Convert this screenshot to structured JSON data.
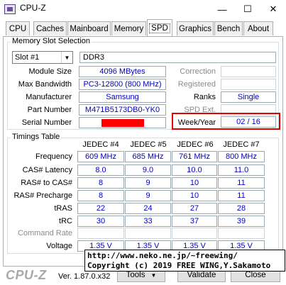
{
  "window": {
    "title": "CPU-Z",
    "minimize": "—",
    "maximize": "☐",
    "close": "✕"
  },
  "tabs": [
    "CPU",
    "Caches",
    "Mainboard",
    "Memory",
    "SPD",
    "Graphics",
    "Bench",
    "About"
  ],
  "active_tab": "SPD",
  "slot": {
    "group_title": "Memory Slot Selection",
    "selected": "Slot #1",
    "type": "DDR3",
    "module_size_label": "Module Size",
    "module_size": "4096 MBytes",
    "max_bw_label": "Max Bandwidth",
    "max_bw": "PC3-12800 (800 MHz)",
    "manufacturer_label": "Manufacturer",
    "manufacturer": "Samsung",
    "part_label": "Part Number",
    "part": "M471B5173DB0-YK0",
    "serial_label": "Serial Number",
    "correction_label": "Correction",
    "registered_label": "Registered",
    "ranks_label": "Ranks",
    "ranks": "Single",
    "spdext_label": "SPD Ext.",
    "weekyear_label": "Week/Year",
    "weekyear": "02 / 16"
  },
  "timings": {
    "group_title": "Timings Table",
    "columns": [
      "JEDEC #4",
      "JEDEC #5",
      "JEDEC #6",
      "JEDEC #7"
    ],
    "rows": [
      {
        "label": "Frequency",
        "values": [
          "609 MHz",
          "685 MHz",
          "761 MHz",
          "800 MHz"
        ]
      },
      {
        "label": "CAS# Latency",
        "values": [
          "8.0",
          "9.0",
          "10.0",
          "11.0"
        ]
      },
      {
        "label": "RAS# to CAS#",
        "values": [
          "8",
          "9",
          "10",
          "11"
        ]
      },
      {
        "label": "RAS# Precharge",
        "values": [
          "8",
          "9",
          "10",
          "11"
        ]
      },
      {
        "label": "tRAS",
        "values": [
          "22",
          "24",
          "27",
          "28"
        ]
      },
      {
        "label": "tRC",
        "values": [
          "30",
          "33",
          "37",
          "39"
        ]
      },
      {
        "label": "Command Rate",
        "values": [
          "",
          "",
          "",
          ""
        ]
      },
      {
        "label": "Voltage",
        "values": [
          "1.35 V",
          "1.35 V",
          "1.35 V",
          "1.35 V"
        ]
      }
    ]
  },
  "footer": {
    "logo": "CPU-Z",
    "version": "Ver. 1.87.0.x32",
    "tools": "Tools",
    "validate": "Validate",
    "close": "Close"
  },
  "overlay": {
    "line1": "http://www.neko.ne.jp/~freewing/",
    "line2": "Copyright (c) 2019 FREE WING,Y.Sakamoto"
  },
  "colors": {
    "value_text": "#0000c8",
    "highlight": "#e00000",
    "redaction": "#ff0000"
  }
}
